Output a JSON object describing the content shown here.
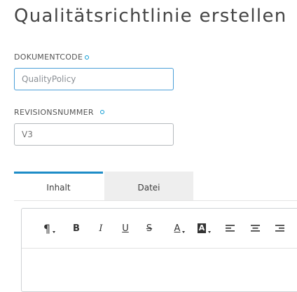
{
  "page": {
    "title": "Qualitätsrichtlinie erstellen"
  },
  "fields": {
    "document_code": {
      "label": "DOKUMENTCODE",
      "value": "QualityPolicy",
      "required": true
    },
    "revision_number": {
      "label": "REVISIONSNUMMER",
      "placeholder": "V3",
      "required": true
    }
  },
  "tabs": [
    {
      "label": "Inhalt",
      "active": true
    },
    {
      "label": "Datei",
      "active": false
    }
  ],
  "toolbar": {
    "buttons": [
      {
        "icon": "paragraph-icon",
        "glyph": "¶"
      },
      {
        "icon": "bold-icon",
        "glyph": "B"
      },
      {
        "icon": "italic-icon",
        "glyph": "I"
      },
      {
        "icon": "underline-icon",
        "glyph": "U"
      },
      {
        "icon": "strikethrough-icon",
        "glyph": "S"
      },
      {
        "icon": "font-color-icon",
        "glyph": "A"
      },
      {
        "icon": "background-color-icon",
        "glyph": "A"
      },
      {
        "icon": "align-left-icon",
        "glyph": ""
      },
      {
        "icon": "align-center-icon",
        "glyph": ""
      },
      {
        "icon": "align-right-icon",
        "glyph": ""
      }
    ]
  },
  "colors": {
    "accent": "#1d8cc7",
    "required_dot": "#0d9bd4",
    "focus_border": "#4a9fd8"
  }
}
